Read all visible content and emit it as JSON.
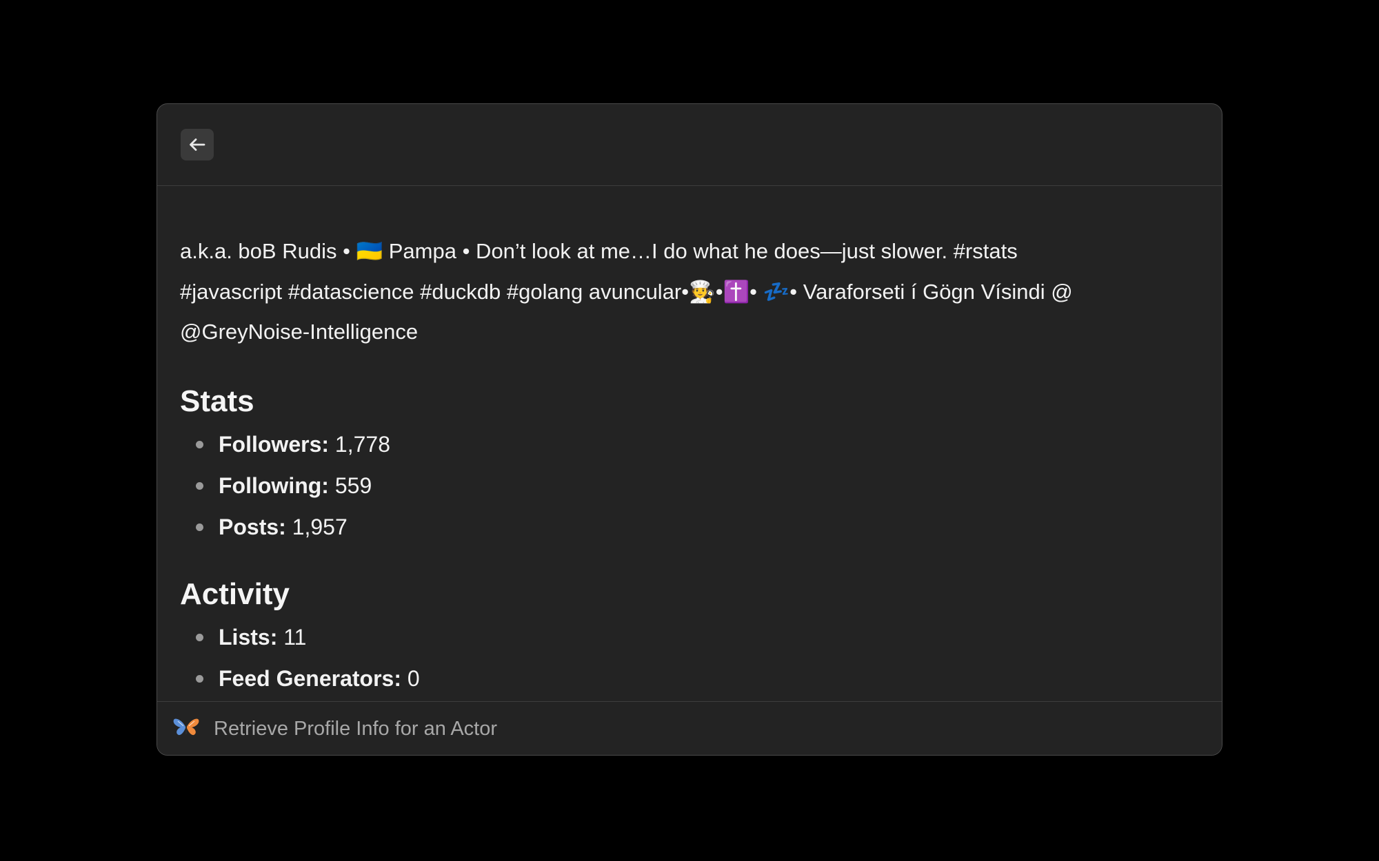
{
  "header": {
    "back_icon": "arrow-left-icon"
  },
  "bio": {
    "line1": "a.k.a. boB Rudis • 🇺🇦 Pampa • Don’t look at me…I do what he does—just slower. #rstats",
    "line2": "#javascript #datascience #duckdb #golang avuncular•🧑‍🍳•✝️• 💤• Varaforseti í Gögn Vísindi @",
    "line3": "@GreyNoise-Intelligence"
  },
  "stats": {
    "title": "Stats",
    "items": [
      {
        "label": "Followers:",
        "value": "1,778"
      },
      {
        "label": "Following:",
        "value": "559"
      },
      {
        "label": "Posts:",
        "value": "1,957"
      }
    ]
  },
  "activity": {
    "title": "Activity",
    "items": [
      {
        "label": "Lists:",
        "value": "11"
      },
      {
        "label": "Feed Generators:",
        "value": "0"
      }
    ]
  },
  "footer": {
    "icon": "butterfly-icon",
    "title": "Retrieve Profile Info for an Actor"
  },
  "colors": {
    "background": "#000000",
    "window": "#232323",
    "text": "#f2f2f2",
    "muted": "#a8a8a8"
  }
}
